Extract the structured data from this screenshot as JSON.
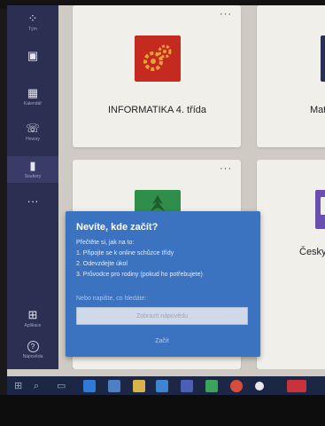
{
  "rail": {
    "items": [
      {
        "icon": "teams-icon",
        "glyph": "⁘",
        "label": "Tým"
      },
      {
        "icon": "assignments-icon",
        "glyph": "▣",
        "label": ""
      },
      {
        "icon": "calendar-icon",
        "glyph": "▦",
        "label": "Kalendář"
      },
      {
        "icon": "calls-icon",
        "glyph": "☏",
        "label": "Hovory"
      },
      {
        "icon": "files-icon",
        "glyph": "▮",
        "label": "Soubory"
      },
      {
        "icon": "more-icon",
        "glyph": "···",
        "label": ""
      },
      {
        "icon": "apps-icon",
        "glyph": "⊞",
        "label": "Aplikace"
      },
      {
        "icon": "help-icon",
        "glyph": "?",
        "label": "Nápověda"
      }
    ]
  },
  "cards": [
    {
      "title": "INFORMATIKA 4. třída",
      "more": "···",
      "tile_color": "#c42a1e"
    },
    {
      "title": "Mat",
      "more": "",
      "tile_color": "#2a2f55"
    },
    {
      "title": "",
      "more": "···",
      "tile_color": "#2f8f4a"
    },
    {
      "title": "Česky",
      "more": "",
      "tile_color": "#6a4fb0"
    }
  ],
  "popup": {
    "title": "Nevíte, kde začít?",
    "lines": [
      "Přečtěte si, jak na to:",
      "1. Připojte se k online schůzce třídy",
      "2. Odevzdejte úkol",
      "3. Průvodce pro rodiny (pokud ho potřebujete)"
    ],
    "alt_label": "Nebo napište, co hledáte:",
    "input_placeholder": "Zobrazit nápovědu",
    "button_label": "Začít"
  },
  "taskbar": {
    "items": [
      "start-icon",
      "search-icon",
      "task-view-icon",
      "edge-icon",
      "store-icon",
      "explorer-icon",
      "mail-icon",
      "teams-icon",
      "chrome-icon",
      "settings-icon",
      "app-icon"
    ]
  },
  "colors": {
    "rail": "#2b2f52",
    "popup": "#3b73c0",
    "taskbar": "#1b2744",
    "accent_red": "#c42a1e"
  }
}
